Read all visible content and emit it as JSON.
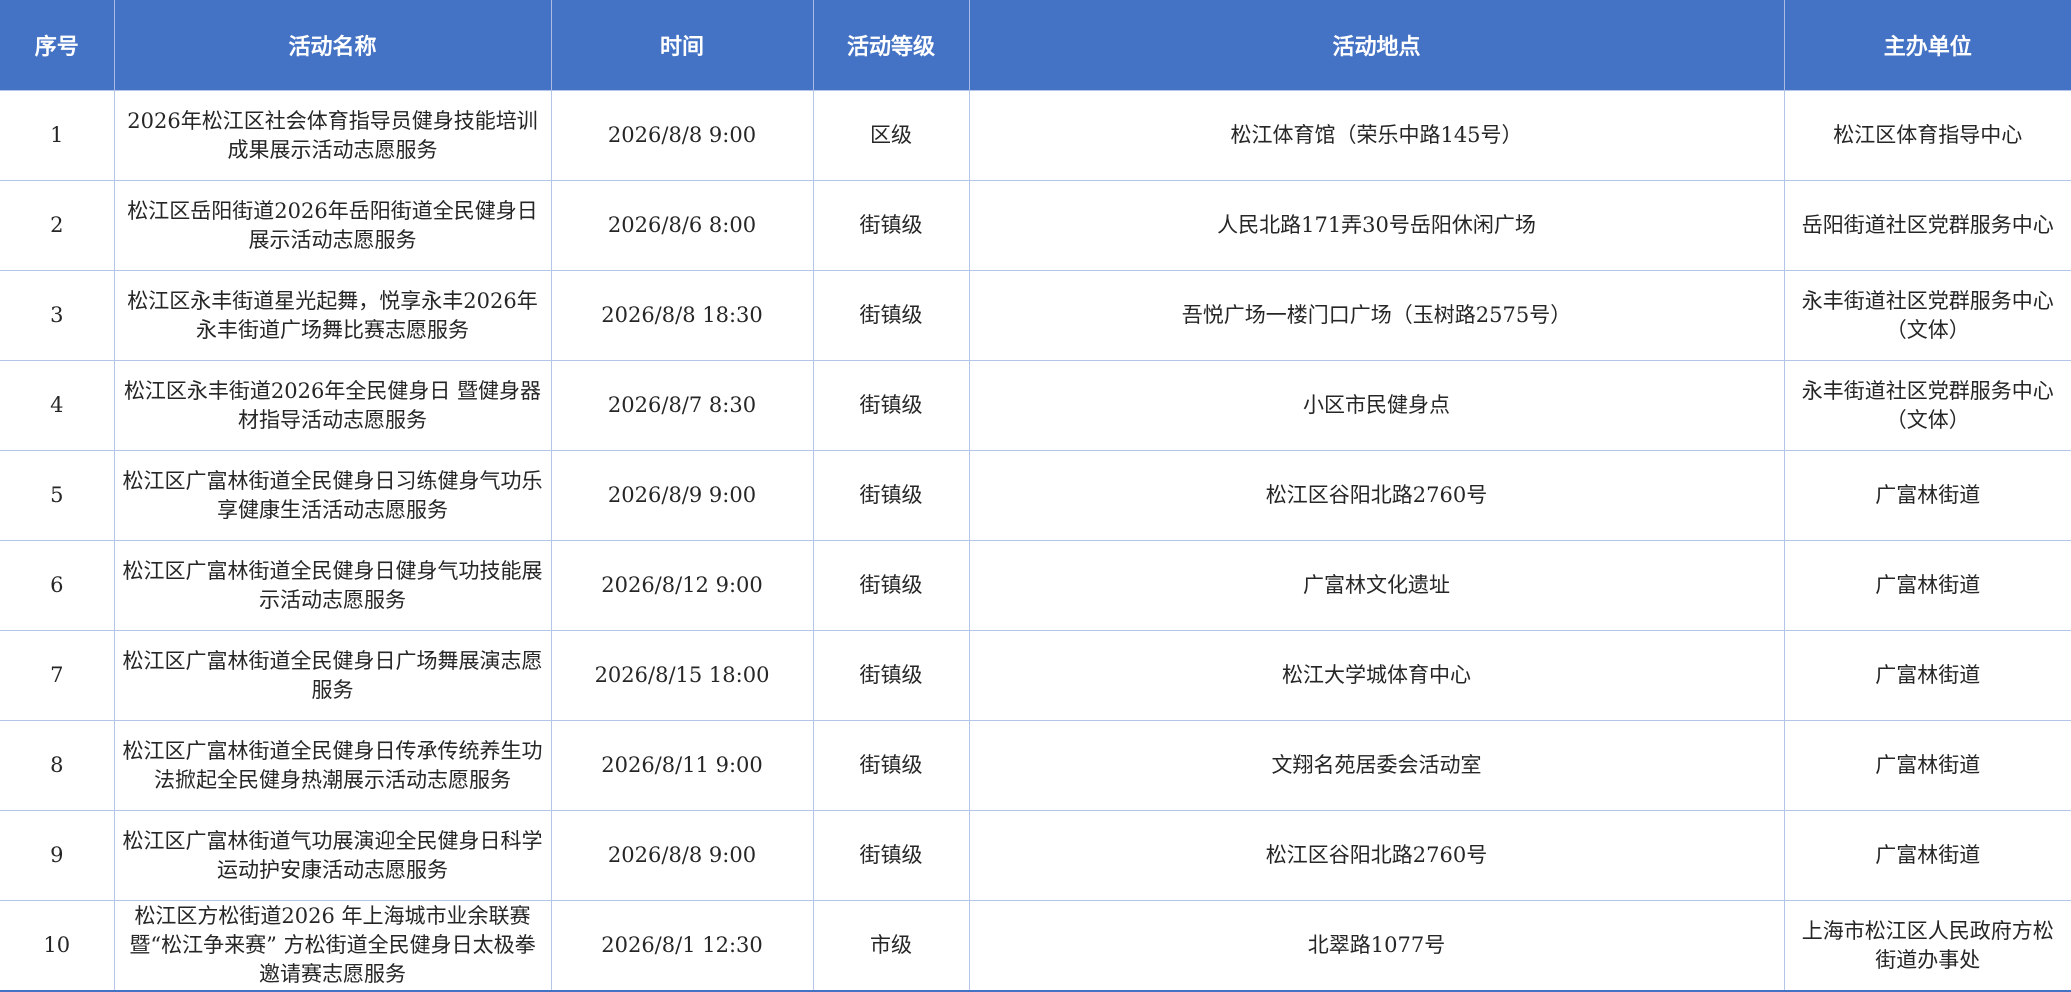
{
  "table": {
    "headers": [
      "序号",
      "活动名称",
      "时间",
      "活动等级",
      "活动地点",
      "主办单位"
    ],
    "rows": [
      [
        "1",
        "2026年松江区社会体育指导员健身技能培训成果展示活动志愿服务",
        "2026/8/8 9:00",
        "区级",
        "松江体育馆（荣乐中路145号）",
        "松江区体育指导中心"
      ],
      [
        "2",
        "松江区岳阳街道2026年岳阳街道全民健身日展示活动志愿服务",
        "2026/8/6 8:00",
        "街镇级",
        "人民北路171弄30号岳阳休闲广场",
        "岳阳街道社区党群服务中心"
      ],
      [
        "3",
        "松江区永丰街道星光起舞，悦享永丰2026年永丰街道广场舞比赛志愿服务",
        "2026/8/8 18:30",
        "街镇级",
        "吾悦广场一楼门口广场（玉树路2575号）",
        "永丰街道社区党群服务中心（文体）"
      ],
      [
        "4",
        "松江区永丰街道2026年全民健身日 暨健身器材指导活动志愿服务",
        "2026/8/7 8:30",
        "街镇级",
        "小区市民健身点",
        "永丰街道社区党群服务中心（文体）"
      ],
      [
        "5",
        "松江区广富林街道全民健身日习练健身气功乐享健康生活活动志愿服务",
        "2026/8/9 9:00",
        "街镇级",
        "松江区谷阳北路2760号",
        "广富林街道"
      ],
      [
        "6",
        "松江区广富林街道全民健身日健身气功技能展示活动志愿服务",
        "2026/8/12 9:00",
        "街镇级",
        "广富林文化遗址",
        "广富林街道"
      ],
      [
        "7",
        "松江区广富林街道全民健身日广场舞展演志愿服务",
        "2026/8/15 18:00",
        "街镇级",
        "松江大学城体育中心",
        "广富林街道"
      ],
      [
        "8",
        "松江区广富林街道全民健身日传承传统养生功法掀起全民健身热潮展示活动志愿服务",
        "2026/8/11 9:00",
        "街镇级",
        "文翔名苑居委会活动室",
        "广富林街道"
      ],
      [
        "9",
        "松江区广富林街道气功展演迎全民健身日科学运动护安康活动志愿服务",
        "2026/8/8 9:00",
        "街镇级",
        "松江区谷阳北路2760号",
        "广富林街道"
      ],
      [
        "10",
        "松江区方松街道2026 年上海城市业余联赛暨“松江争来赛” 方松街道全民健身日太极拳邀请赛志愿服务",
        "2026/8/1 12:30",
        "市级",
        "北翠路1077号",
        "上海市松江区人民政府方松街道办事处"
      ]
    ]
  }
}
